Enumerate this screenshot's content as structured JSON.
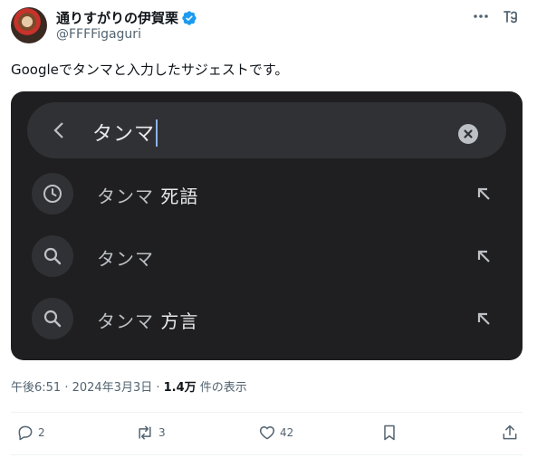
{
  "author": {
    "display_name": "通りすがりの伊賀栗",
    "handle": "@FFFFigaguri",
    "verified": true
  },
  "tweet": {
    "text": "Googleでタンマと入力したサジェストです。"
  },
  "media": {
    "search_query": "タンマ",
    "suggestions": [
      {
        "icon": "history-clock-icon",
        "base": "タンマ",
        "extra": " 死語"
      },
      {
        "icon": "search-icon",
        "base": "タンマ",
        "extra": ""
      },
      {
        "icon": "search-icon",
        "base": "タンマ",
        "extra": " 方言"
      }
    ]
  },
  "meta": {
    "time": "午後6:51 · 2024年3月3日 · ",
    "views": "1.4万",
    "views_suffix": " 件の表示"
  },
  "actions": {
    "replies": "2",
    "reposts": "3",
    "likes": "42"
  },
  "colors": {
    "verified_blue": "#1d9bf0",
    "media_bg": "#1f1f21",
    "caret": "#8ab4f8"
  }
}
